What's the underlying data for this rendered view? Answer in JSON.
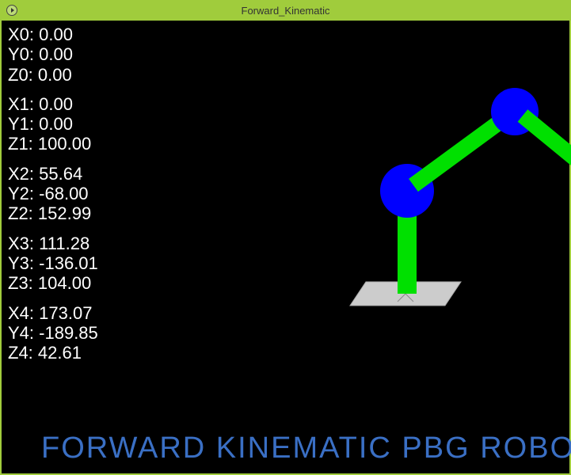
{
  "window": {
    "title": "Forward_Kinematic"
  },
  "joints": [
    {
      "x_label": "X0:",
      "x_val": "0.00",
      "y_label": "Y0:",
      "y_val": "0.00",
      "z_label": "Z0:",
      "z_val": "0.00"
    },
    {
      "x_label": "X1:",
      "x_val": "0.00",
      "y_label": "Y1:",
      "y_val": "0.00",
      "z_label": "Z1:",
      "z_val": "100.00"
    },
    {
      "x_label": "X2:",
      "x_val": "55.64",
      "y_label": "Y2:",
      "y_val": "-68.00",
      "z_label": "Z2:",
      "z_val": "152.99"
    },
    {
      "x_label": "X3:",
      "x_val": "111.28",
      "y_label": "Y3:",
      "y_val": "-136.01",
      "z_label": "Z3:",
      "z_val": "104.00"
    },
    {
      "x_label": "X4:",
      "x_val": "173.07",
      "y_label": "Y4:",
      "y_val": "-189.85",
      "z_label": "Z4:",
      "z_val": "42.61"
    }
  ],
  "banner_text": "FORWARD KINEMATIC PBG ROBOT",
  "colors": {
    "link": "#00e000",
    "joint": "#0000ff",
    "base_plate": "#cccccc",
    "bg": "#000000",
    "chrome": "#a0cc3c"
  }
}
